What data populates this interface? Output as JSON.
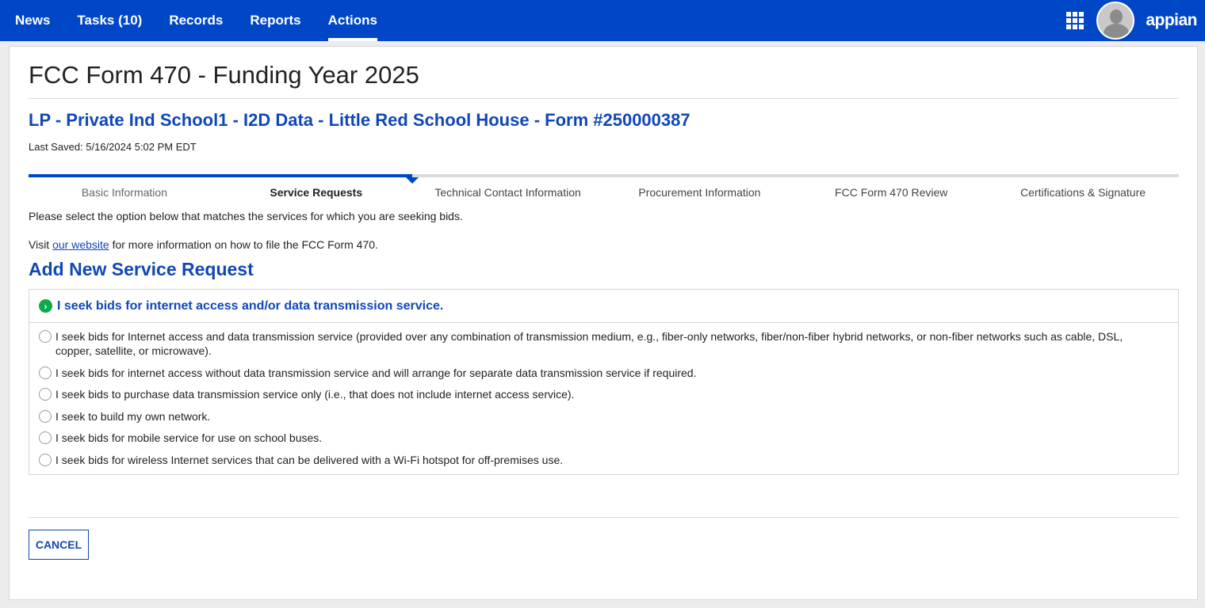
{
  "nav": {
    "items": [
      {
        "label": "News"
      },
      {
        "label": "Tasks (10)"
      },
      {
        "label": "Records"
      },
      {
        "label": "Reports"
      },
      {
        "label": "Actions",
        "active": true
      }
    ],
    "brand": "appian"
  },
  "page": {
    "title": "FCC Form 470 - Funding Year 2025",
    "form_name": "LP - Private Ind School1 - I2D Data - Little Red School House - Form #250000387",
    "last_saved": "Last Saved: 5/16/2024 5:02 PM EDT"
  },
  "steps": {
    "current_index": 1,
    "items": [
      {
        "label": "Basic Information"
      },
      {
        "label": "Service Requests"
      },
      {
        "label": "Technical Contact Information"
      },
      {
        "label": "Procurement Information"
      },
      {
        "label": "FCC Form 470 Review"
      },
      {
        "label": "Certifications & Signature"
      }
    ]
  },
  "instructions": {
    "line1": "Please select the option below that matches the services for which you are seeking bids.",
    "visit_prefix": "Visit ",
    "link_text": "our website",
    "visit_suffix": " for more information on how to file the FCC Form 470."
  },
  "section": {
    "heading": "Add New Service Request",
    "box_title": "I seek bids for internet access and/or data transmission service.",
    "options": [
      {
        "label": "I seek bids for Internet access and data transmission service (provided over any combination of transmission medium, e.g., fiber-only networks, fiber/non-fiber hybrid networks, or non-fiber networks such as cable, DSL, copper, satellite, or microwave).",
        "selected": false
      },
      {
        "label": "I seek bids for internet access without data transmission service and will arrange for separate data transmission service if required.",
        "selected": false
      },
      {
        "label": "I seek bids to purchase data transmission service only (i.e., that does not include internet access service).",
        "selected": false
      },
      {
        "label": "I seek to build my own network.",
        "selected": false
      },
      {
        "label": "I seek bids for mobile service for use on school buses.",
        "selected": false
      },
      {
        "label": "I seek bids for wireless Internet services that can be delivered with a Wi-Fi hotspot for off-premises use.",
        "selected": false
      }
    ]
  },
  "buttons": {
    "cancel": "CANCEL"
  },
  "colors": {
    "topbar": "#0047c8",
    "accent": "#1047b8",
    "success": "#0da94a"
  }
}
